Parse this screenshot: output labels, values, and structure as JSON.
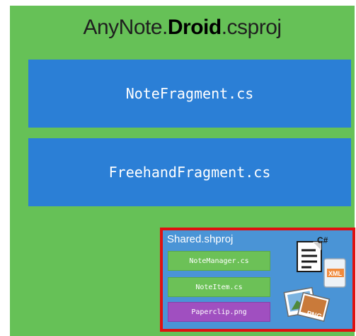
{
  "project": {
    "title_prefix": "AnyNote.",
    "title_bold": "Droid",
    "title_suffix": ".csproj"
  },
  "files": [
    {
      "name": "NoteFragment.cs"
    },
    {
      "name": "FreehandFragment.cs"
    }
  ],
  "shared_project": {
    "title": "Shared.shproj",
    "files": [
      {
        "name": "NoteManager.cs"
      },
      {
        "name": "NoteItem.cs"
      },
      {
        "name": "Paperclip.png"
      }
    ],
    "icon_labels": {
      "csharp": "C#",
      "xml": "XML",
      "png": "PNG"
    }
  },
  "colors": {
    "project_background": "#66c157",
    "file_box": "#2b7fd6",
    "shared_frame_highlight": "#e01010",
    "shared_background": "#4a94d6",
    "cs_file": "#6cc157",
    "png_file": "#a04fc0"
  }
}
